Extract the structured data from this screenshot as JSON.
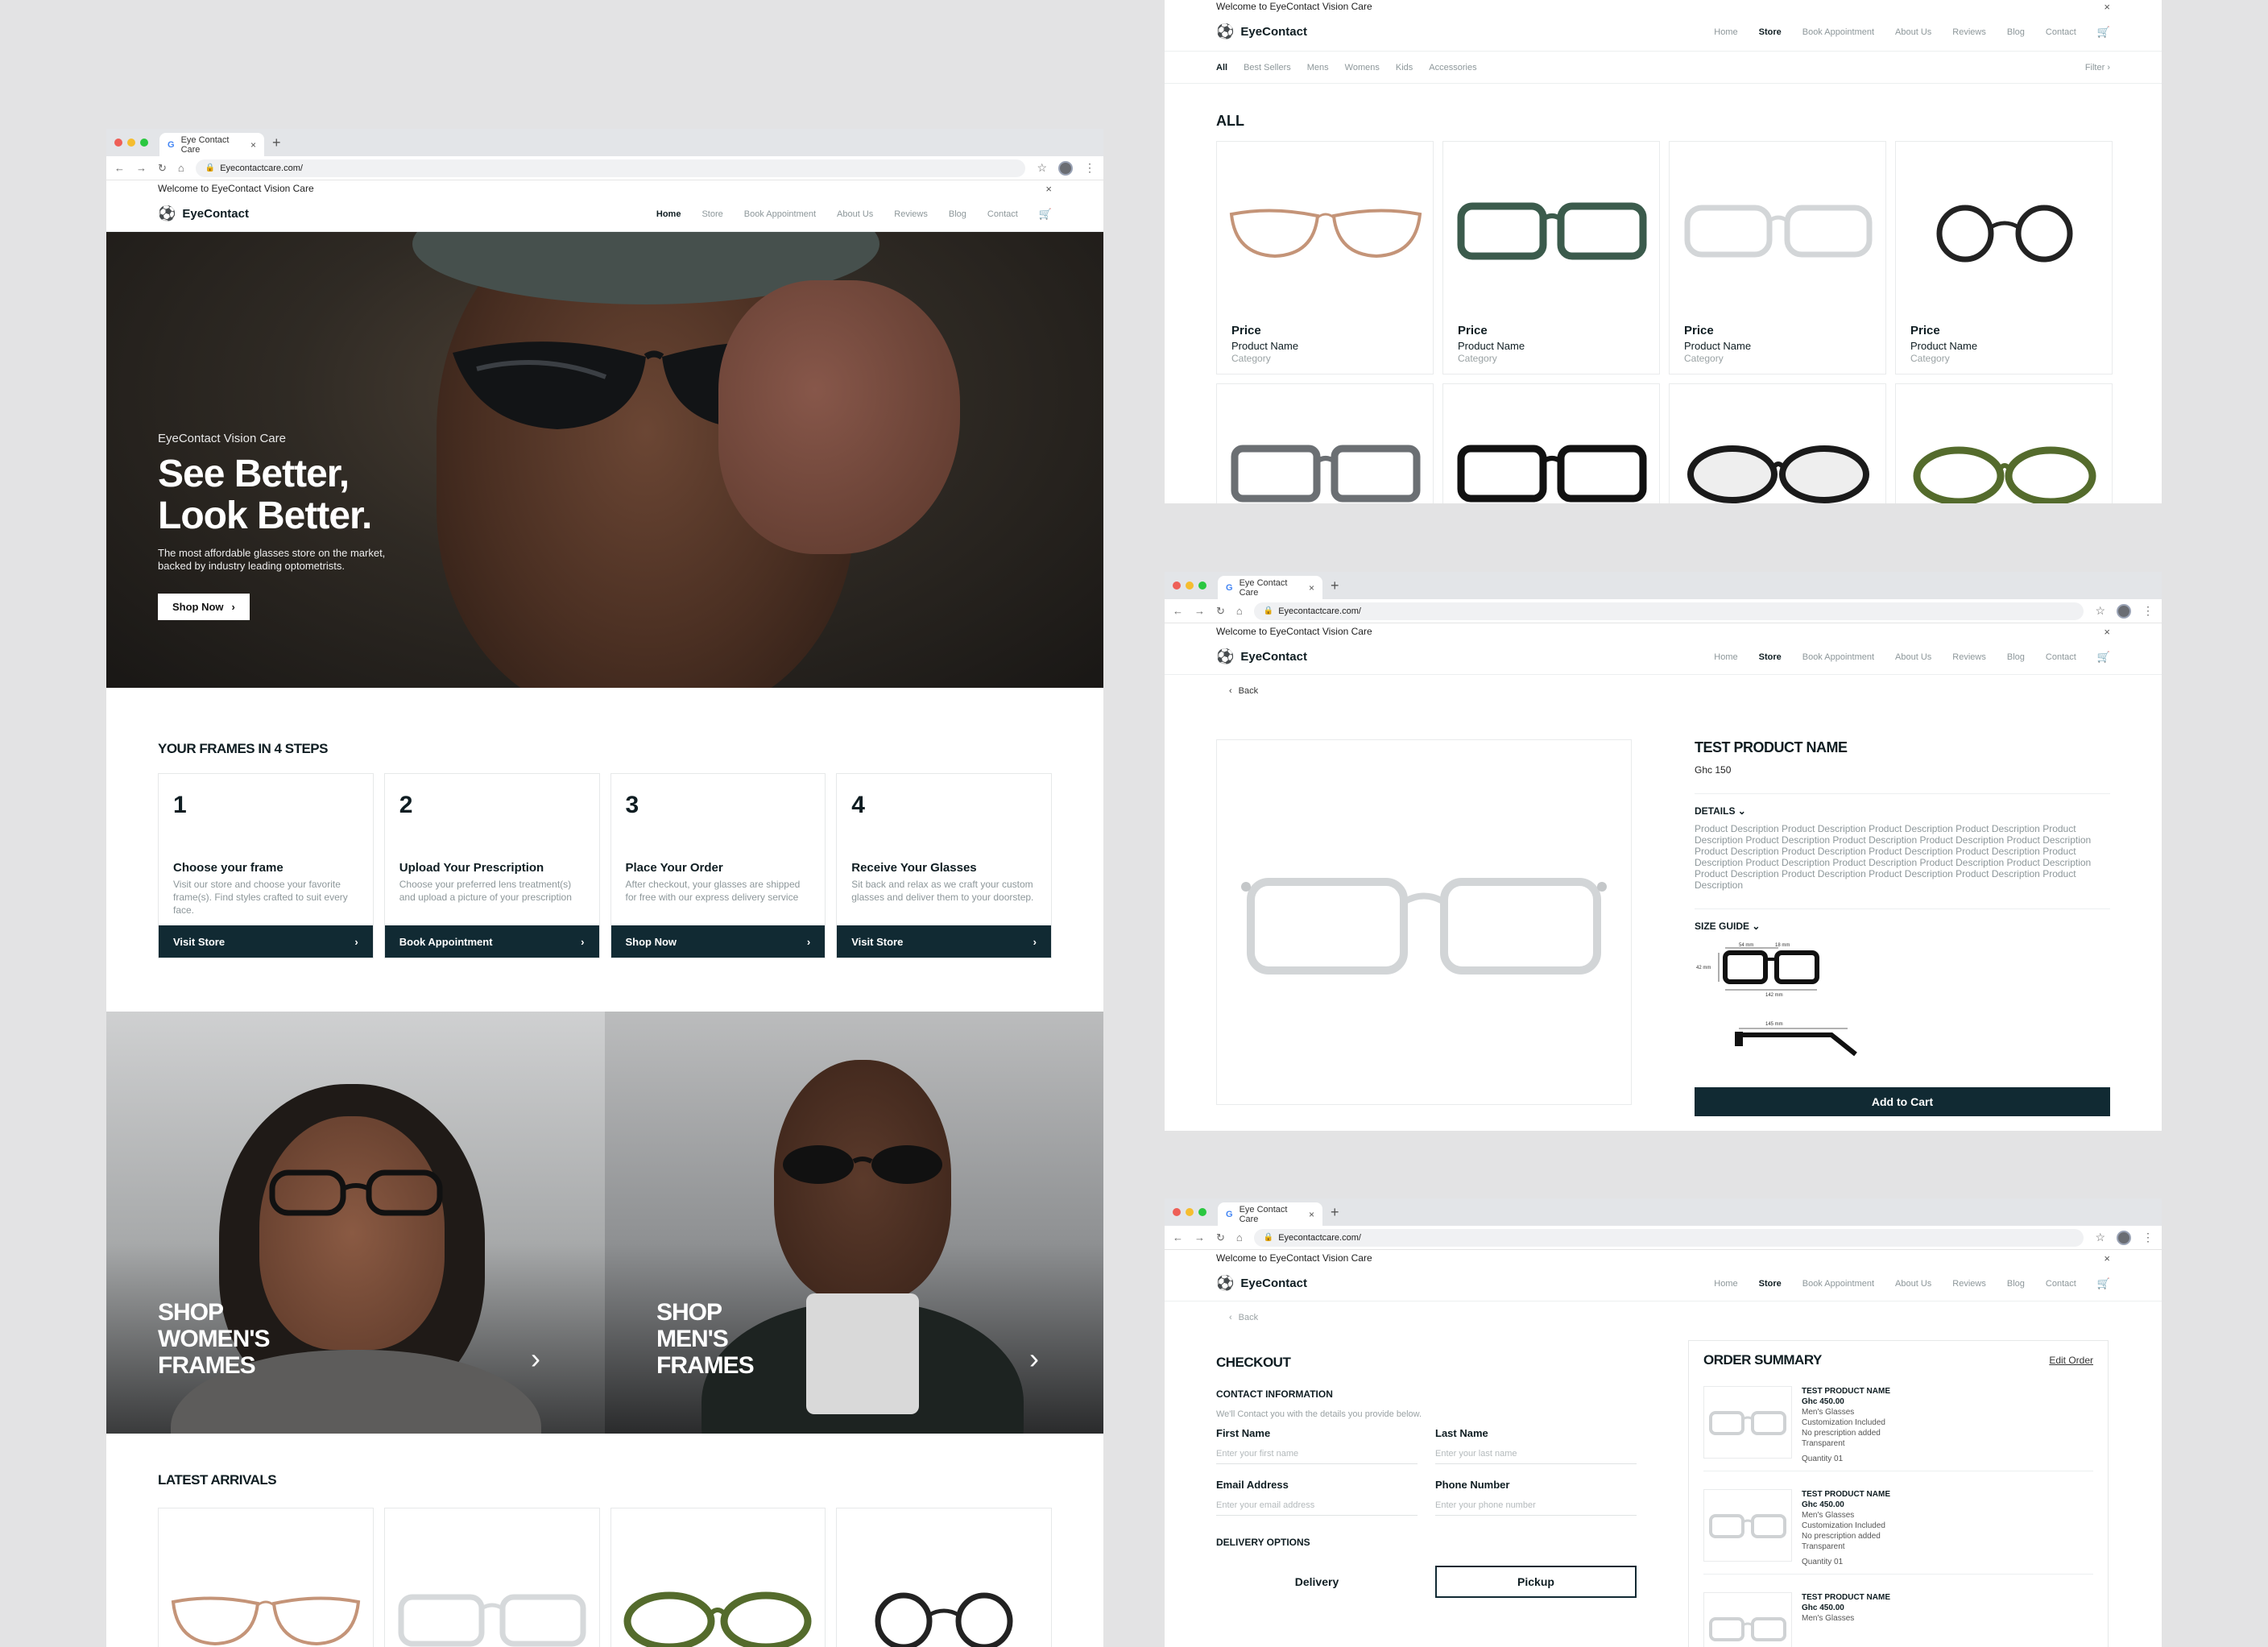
{
  "browser": {
    "tab_title": "Eye Contact Care",
    "tab_close": "×",
    "new_tab": "+",
    "url": "Eyecontactcare.com/"
  },
  "site": {
    "welcome": "Welcome to EyeContact Vision Care",
    "brand": "EyeContact",
    "nav": [
      "Home",
      "Store",
      "Book Appointment",
      "About Us",
      "Reviews",
      "Blog",
      "Contact"
    ]
  },
  "home": {
    "hero_sub": "EyeContact Vision Care",
    "hero_title_1": "See Better,",
    "hero_title_2": "Look Better.",
    "hero_desc": "The most affordable glasses store on the market, backed by industry leading optometrists.",
    "hero_button": "Shop Now",
    "steps_title": "YOUR FRAMES IN 4 STEPS",
    "steps": [
      {
        "num": "1",
        "title": "Choose your frame",
        "desc": "Visit our store and choose your favorite frame(s). Find styles crafted to suit every face.",
        "button": "Visit Store"
      },
      {
        "num": "2",
        "title": "Upload Your Prescription",
        "desc": "Choose your preferred lens treatment(s) and upload a picture of your prescription",
        "button": "Book Appointment"
      },
      {
        "num": "3",
        "title": "Place Your Order",
        "desc": "After checkout, your glasses are shipped for free with our express delivery service",
        "button": "Shop Now"
      },
      {
        "num": "4",
        "title": "Receive Your Glasses",
        "desc": "Sit back and relax as we craft your custom glasses and deliver them to your doorstep.",
        "button": "Visit Store"
      }
    ],
    "shop_women": [
      "SHOP",
      "WOMEN'S",
      "FRAMES"
    ],
    "shop_men": [
      "SHOP",
      "MEN'S",
      "FRAMES"
    ],
    "latest_title": "LATEST ARRIVALS"
  },
  "store": {
    "filters": [
      "All",
      "Best Sellers",
      "Mens",
      "Womens",
      "Kids",
      "Accessories"
    ],
    "filter_label": "Filter",
    "title": "ALL",
    "product": {
      "price": "Price",
      "name": "Product Name",
      "category": "Category"
    }
  },
  "product_page": {
    "back": "Back",
    "title": "TEST PRODUCT NAME",
    "price": "Ghc 150",
    "details_label": "DETAILS",
    "description": "Product Description Product Description Product Description Product Description Product Description Product Description Product Description Product Description Product Description Product Description Product Description Product Description Product Description Product Description Product Description Product Description Product Description Product Description Product Description Product Description Product Description Product Description Product Description",
    "size_guide_label": "SIZE GUIDE",
    "size_guide": {
      "lens_width": "54 mm",
      "bridge": "18 mm",
      "lens_height": "42 mm",
      "frame_width": "142 mm",
      "temple": "145 mm"
    },
    "add_to_cart": "Add to Cart"
  },
  "checkout": {
    "back": "Back",
    "title": "CHECKOUT",
    "contact_label": "CONTACT INFORMATION",
    "contact_note": "We'll Contact you with the details you provide below.",
    "first_name": {
      "label": "First Name",
      "placeholder": "Enter your first name"
    },
    "last_name": {
      "label": "Last Name",
      "placeholder": "Enter your last name"
    },
    "email": {
      "label": "Email Address",
      "placeholder": "Enter your email address"
    },
    "phone": {
      "label": "Phone Number",
      "placeholder": "Enter your phone number"
    },
    "delivery_label": "DELIVERY OPTIONS",
    "delivery_options": [
      "Delivery",
      "Pickup"
    ],
    "selected_option": "Pickup",
    "summary_title": "ORDER SUMMARY",
    "edit_order": "Edit Order",
    "item": {
      "name": "TEST PRODUCT NAME",
      "price": "Ghc 450.00",
      "type": "Men's Glasses",
      "custom": "Customization Included",
      "rx": "No prescription added",
      "color": "Transparent",
      "quantity": "Quantity  01"
    }
  },
  "icons": {
    "arrow": "›",
    "close": "×",
    "cart": "cart-icon",
    "star": "☆"
  }
}
